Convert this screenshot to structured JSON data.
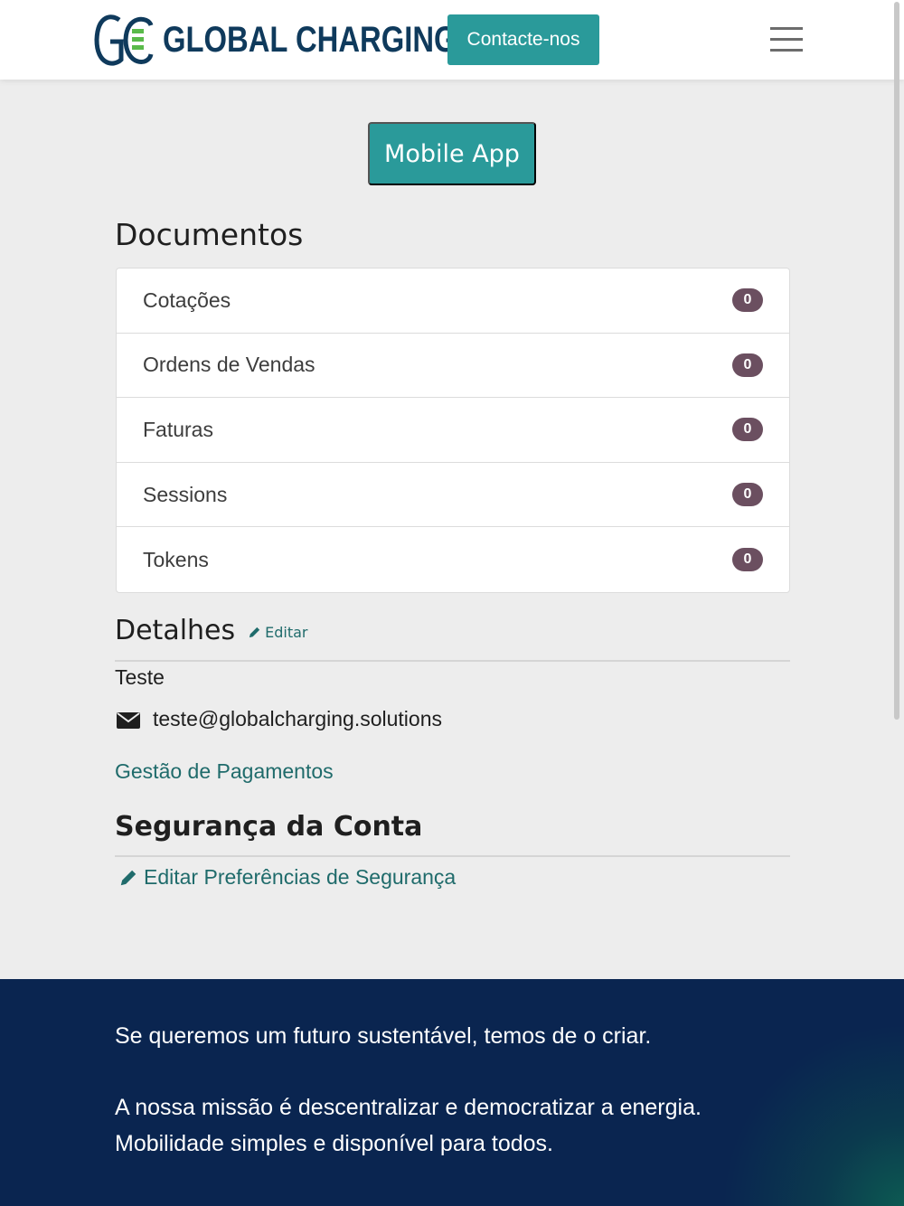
{
  "header": {
    "brand": "GLOBAL CHARGING",
    "contact_label": "Contacte-nos",
    "menu_icon": "hamburger-icon"
  },
  "main": {
    "mobile_app_label": "Mobile App",
    "documents_title": "Documentos",
    "documents": [
      {
        "label": "Cotações",
        "count": "0"
      },
      {
        "label": "Ordens de Vendas",
        "count": "0"
      },
      {
        "label": "Faturas",
        "count": "0"
      },
      {
        "label": "Sessions",
        "count": "0"
      },
      {
        "label": "Tokens",
        "count": "0"
      }
    ],
    "details_title": "Detalhes",
    "edit_label": "Editar",
    "user_name": "Teste",
    "user_email": "teste@globalcharging.solutions",
    "payments_link": "Gestão de Pagamentos",
    "security_title": "Segurança da Conta",
    "security_link": "Editar Preferências de Segurança"
  },
  "footer": {
    "line1": "Se queremos um futuro sustentável, temos de o criar.",
    "line2": "A nossa missão é descentralizar e democratizar a energia.",
    "line3": "Mobilidade simples e disponível para todos."
  },
  "colors": {
    "accent": "#2a9a9a",
    "link": "#1f6b6b",
    "brand_dark": "#0f3a5c",
    "badge": "#6b4f60",
    "footer": "#0a2550"
  }
}
